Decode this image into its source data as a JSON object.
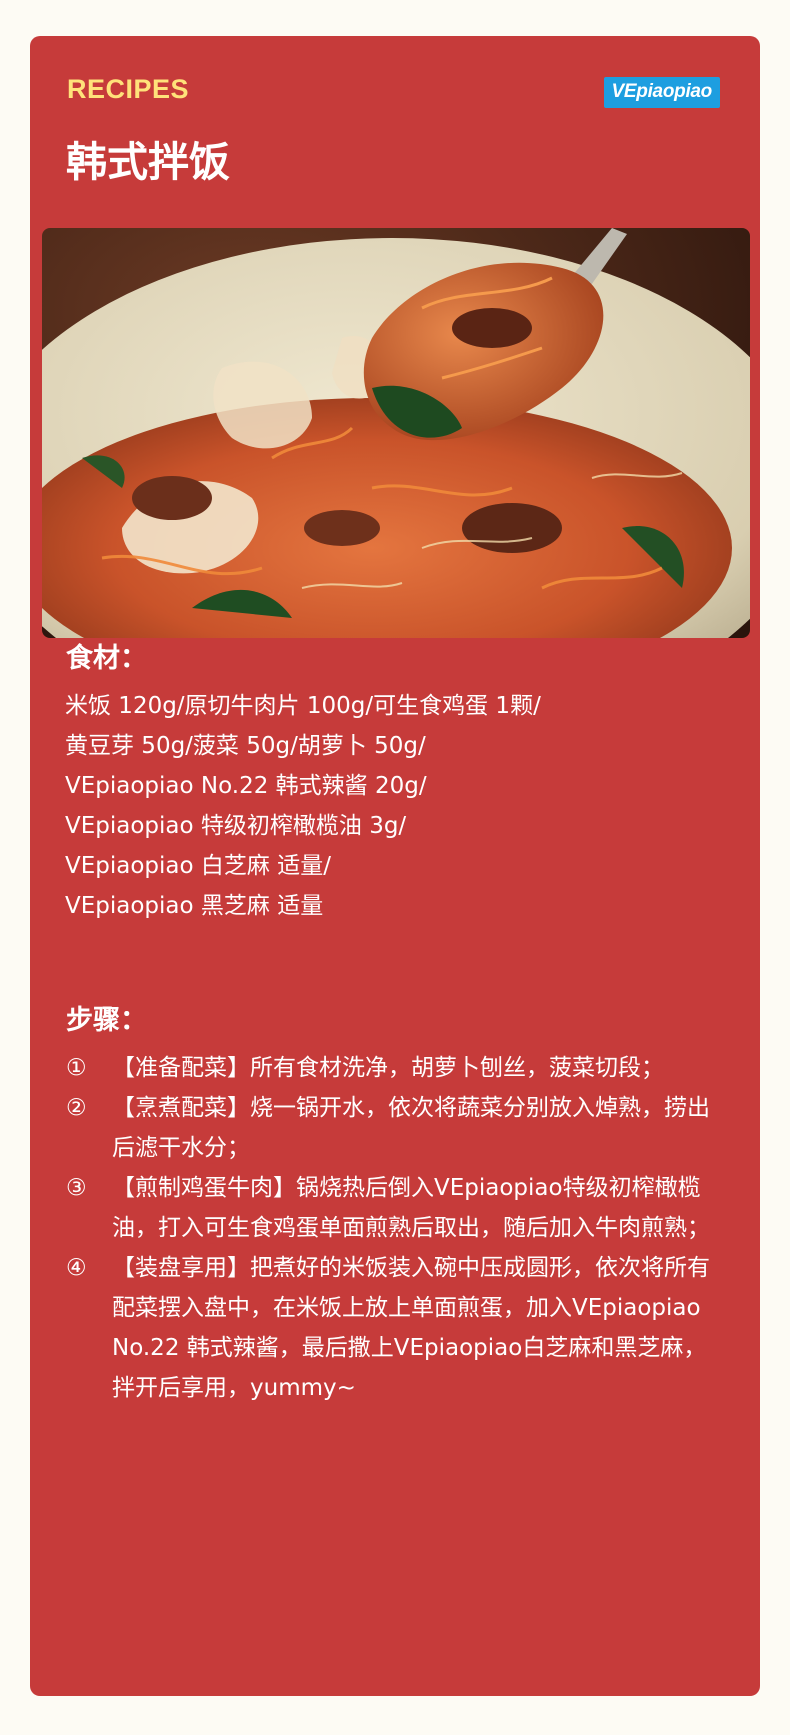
{
  "header": {
    "eyebrow": "RECIPES",
    "brand": "VEpiaopiao",
    "title": "韩式拌饭"
  },
  "photo": {
    "subject": "bibimbap-bowl-with-spoon"
  },
  "ingredients": {
    "heading": "食材：",
    "lines": [
      "米饭 120g/原切牛肉片 100g/可生食鸡蛋 1颗/",
      "黄豆芽 50g/菠菜 50g/胡萝卜 50g/",
      "VEpiaopiao No.22 韩式辣酱 20g/",
      "VEpiaopiao 特级初榨橄榄油 3g/",
      "VEpiaopiao 白芝麻 适量/",
      "VEpiaopiao 黑芝麻 适量"
    ]
  },
  "steps": {
    "heading": "步骤：",
    "items": [
      {
        "num": "①",
        "text": "【准备配菜】所有食材洗净，胡萝卜刨丝，菠菜切段；"
      },
      {
        "num": "②",
        "text": "【烹煮配菜】烧一锅开水，依次将蔬菜分别放入焯熟，捞出后滤干水分；"
      },
      {
        "num": "③",
        "text": "【煎制鸡蛋牛肉】锅烧热后倒入VEpiaopiao特级初榨橄榄油，打入可生食鸡蛋单面煎熟后取出，随后加入牛肉煎熟；"
      },
      {
        "num": "④",
        "text": "【装盘享用】把煮好的米饭装入碗中压成圆形，依次将所有配菜摆入盘中，在米饭上放上单面煎蛋，加入VEpiaopiao No.22 韩式辣酱，最后撒上VEpiaopiao白芝麻和黑芝麻，拌开后享用，yummy~"
      }
    ]
  },
  "colors": {
    "background": "#fdfbf4",
    "card": "#c63b3a",
    "eyebrow": "#ffe27a",
    "brand": "#1d9ee0",
    "text": "#ffffff"
  }
}
